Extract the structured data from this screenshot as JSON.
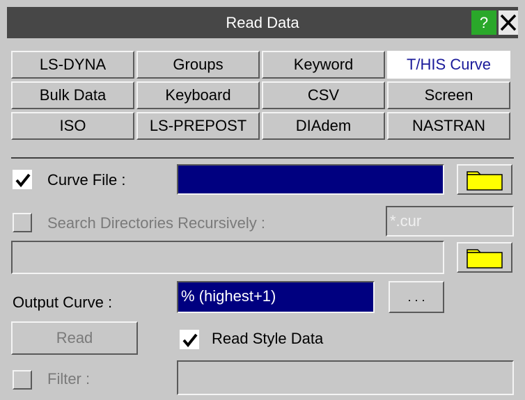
{
  "window": {
    "title": "Read Data",
    "help_label": "?",
    "close_label": "✕"
  },
  "tabs": [
    {
      "label": "LS-DYNA",
      "active": false
    },
    {
      "label": "Groups",
      "active": false
    },
    {
      "label": "Keyword",
      "active": false
    },
    {
      "label": "T/HIS Curve",
      "active": true
    },
    {
      "label": "Bulk Data",
      "active": false
    },
    {
      "label": "Keyboard",
      "active": false
    },
    {
      "label": "CSV",
      "active": false
    },
    {
      "label": "Screen",
      "active": false
    },
    {
      "label": "ISO",
      "active": false
    },
    {
      "label": "LS-PREPOST",
      "active": false
    },
    {
      "label": "DIAdem",
      "active": false
    },
    {
      "label": "NASTRAN",
      "active": false
    }
  ],
  "curve_file": {
    "checked": true,
    "label": "Curve File :",
    "value": ""
  },
  "search_dirs": {
    "checked": false,
    "label": "Search Directories Recursively :",
    "pattern": "*.cur"
  },
  "directory_field": {
    "value": ""
  },
  "output_curve": {
    "label": "Output Curve :",
    "value": "% (highest+1)",
    "more_label": ". . ."
  },
  "read_button": {
    "label": "Read"
  },
  "read_style": {
    "checked": true,
    "label": "Read Style Data"
  },
  "filter": {
    "checked": false,
    "label": "Filter :",
    "value": ""
  },
  "colors": {
    "titlebar": "#474747",
    "panel": "#c8c8c8",
    "selection": "#000080",
    "active_tab_text": "#1a1a9a",
    "folder": "#ffff00",
    "help": "#2aa82a"
  }
}
